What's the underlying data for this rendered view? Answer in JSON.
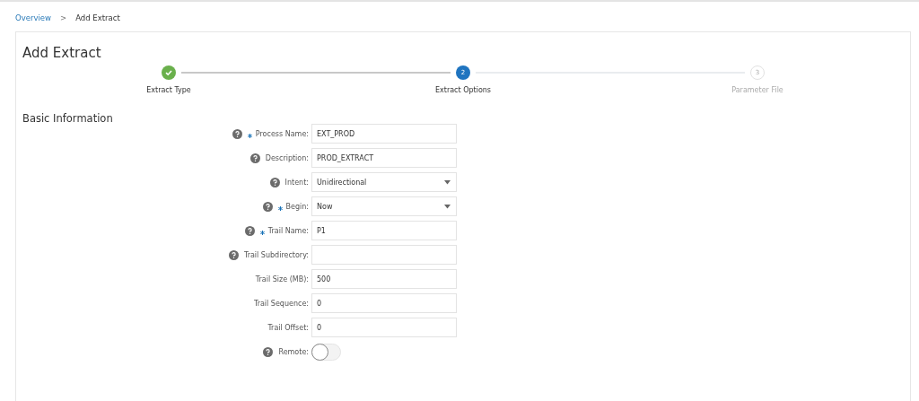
{
  "breadcrumb": [
    {
      "label": "Overview",
      "kind": "link"
    },
    {
      "label": "Add Extract",
      "kind": "current"
    }
  ],
  "breadcrumb_separator": ">",
  "title": "Add Extract",
  "steps": [
    {
      "label": "Extract Type",
      "complete": true,
      "selected": false
    },
    {
      "label": "Extract Options",
      "number": "2",
      "complete": false,
      "selected": true
    },
    {
      "label": "Parameter File",
      "number": "3",
      "complete": false,
      "selected": false
    }
  ],
  "section_title": "Basic Information",
  "fields": [
    {
      "label": "Process Name:",
      "kind": "text",
      "help": true,
      "required": true,
      "value": "EXT_PROD"
    },
    {
      "label": "Description:",
      "kind": "text",
      "help": true,
      "required": false,
      "value": "PROD_EXTRACT"
    },
    {
      "label": "Intent:",
      "kind": "select",
      "help": true,
      "required": false,
      "value": "Unidirectional"
    },
    {
      "label": "Begin:",
      "kind": "select",
      "help": true,
      "required": true,
      "value": "Now"
    },
    {
      "label": "Trail Name:",
      "kind": "text",
      "help": true,
      "required": true,
      "value": "P1"
    },
    {
      "label": "Trail Subdirectory:",
      "kind": "text",
      "help": true,
      "required": false
    },
    {
      "label": "Trail Size (MB):",
      "kind": "text",
      "help": false,
      "required": false,
      "value": "500"
    },
    {
      "label": "Trail Sequence:",
      "kind": "text",
      "help": false,
      "required": false,
      "value": "0"
    },
    {
      "label": "Trail Offset:",
      "kind": "text",
      "help": false,
      "required": false,
      "value": "0"
    },
    {
      "label": "Remote:",
      "kind": "toggle",
      "help": true,
      "required": false,
      "on": false
    }
  ]
}
